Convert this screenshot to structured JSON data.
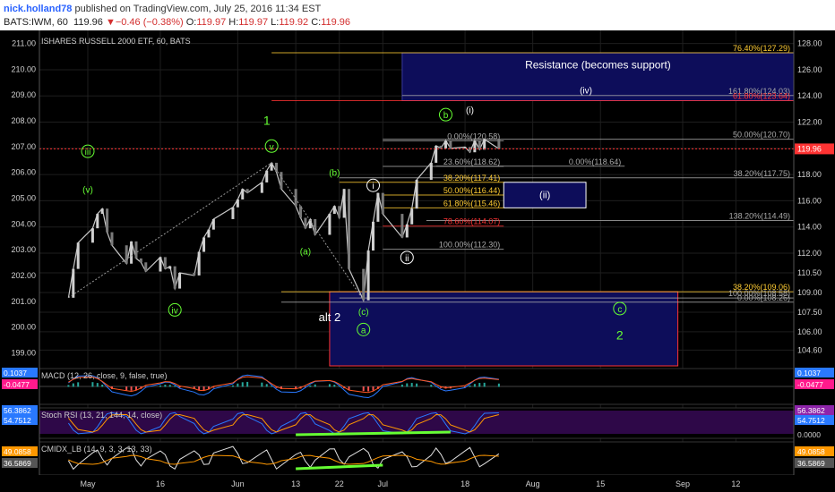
{
  "header": {
    "user": "nick.holland78",
    "published": " published on TradingView.com, July 25, 2016 11:34 EST",
    "symbol": "BATS:IWM, 60",
    "last": "119.96",
    "change_arrow": "▼",
    "change": "−0.46 (−0.38%)",
    "o_label": "O:",
    "o_value": "119.97",
    "h_label": "H:",
    "h_value": "119.97",
    "l_label": "L:",
    "l_value": "119.92",
    "c_label": "C:",
    "c_value": "119.96"
  },
  "colors": {
    "background": "#000000",
    "grid": "#1e1e1e",
    "axis_text": "#d0d0d0",
    "candle": "#c8c8c8",
    "wave_green": "#66ff33",
    "wave_white": "#ffffff",
    "box_navy": "#0d0d5a",
    "box_red_border": "#ff3333",
    "fib_red": "#ff3333",
    "fib_gold": "#ffcc33",
    "fib_gray": "#aaaaaa",
    "macd": "#2979ff",
    "signal": "#ff5722",
    "hist_pos": "#26a69a",
    "hist_neg": "#ef5350",
    "rsi_k": "#2979ff",
    "rsi_d": "#ff9800",
    "rsi_band": "#3a0a5a",
    "divergence": "#66ff33",
    "last_price": "#ff3333",
    "cmi_color": "#e0e0e0"
  },
  "chart_data": {
    "type": "line",
    "title": "ISHARES RUSSELL 2000 ETF, 60, BATS",
    "left_axis": {
      "ticks": [
        "211.00",
        "210.00",
        "209.00",
        "208.00",
        "207.00",
        "206.00",
        "205.00",
        "204.00",
        "203.00",
        "202.00",
        "201.00",
        "200.00",
        "199.00"
      ],
      "range": [
        198.5,
        211.5
      ]
    },
    "right_axis": {
      "ticks": [
        "128.00",
        "126.00",
        "124.00",
        "122.00",
        "120.00",
        "118.00",
        "116.00",
        "114.00",
        "112.00",
        "110.50",
        "109.00",
        "107.50",
        "106.00",
        "104.60"
      ],
      "range": [
        103.4,
        129.0
      ]
    },
    "x_ticks": [
      "May",
      "16",
      "Jun",
      "13",
      "22",
      "Jul",
      "18",
      "Aug",
      "15",
      "Sep",
      "12"
    ],
    "last_price": "119.96",
    "price_series": [
      {
        "t": "Apr 27",
        "v": 108.6
      },
      {
        "t": "Apr 28",
        "v": 110.8
      },
      {
        "t": "Apr 29",
        "v": 112.8
      },
      {
        "t": "May 02",
        "v": 113.9
      },
      {
        "t": "May 03",
        "v": 115.0
      },
      {
        "t": "May 04",
        "v": 115.4
      },
      {
        "t": "May 05",
        "v": 113.6
      },
      {
        "t": "May 06",
        "v": 112.6
      },
      {
        "t": "May 09",
        "v": 111.2
      },
      {
        "t": "May 10",
        "v": 112.9
      },
      {
        "t": "May 11",
        "v": 111.6
      },
      {
        "t": "May 12",
        "v": 111.3
      },
      {
        "t": "May 13",
        "v": 110.6
      },
      {
        "t": "May 16",
        "v": 111.7
      },
      {
        "t": "May 17",
        "v": 110.8
      },
      {
        "t": "May 18",
        "v": 111.0
      },
      {
        "t": "May 19",
        "v": 109.3
      },
      {
        "t": "May 20",
        "v": 110.5
      },
      {
        "t": "May 23",
        "v": 110.3
      },
      {
        "t": "May 24",
        "v": 112.1
      },
      {
        "t": "May 25",
        "v": 113.2
      },
      {
        "t": "May 26",
        "v": 113.8
      },
      {
        "t": "May 27",
        "v": 114.6
      },
      {
        "t": "May 31",
        "v": 115.5
      },
      {
        "t": "Jun 01",
        "v": 116.1
      },
      {
        "t": "Jun 02",
        "v": 116.9
      },
      {
        "t": "Jun 03",
        "v": 116.6
      },
      {
        "t": "Jun 06",
        "v": 117.4
      },
      {
        "t": "Jun 07",
        "v": 118.3
      },
      {
        "t": "Jun 08",
        "v": 118.9
      },
      {
        "t": "Jun 09",
        "v": 118.2
      },
      {
        "t": "Jun 10",
        "v": 116.9
      },
      {
        "t": "Jun 13",
        "v": 115.6
      },
      {
        "t": "Jun 14",
        "v": 114.7
      },
      {
        "t": "Jun 15",
        "v": 113.9
      },
      {
        "t": "Jun 16",
        "v": 114.6
      },
      {
        "t": "Jun 17",
        "v": 113.4
      },
      {
        "t": "Jun 20",
        "v": 115.0
      },
      {
        "t": "Jun 21",
        "v": 115.6
      },
      {
        "t": "Jun 22",
        "v": 114.7
      },
      {
        "t": "Jun 23",
        "v": 116.9
      },
      {
        "t": "Jun 24",
        "v": 110.8
      },
      {
        "t": "Jun 27",
        "v": 108.4
      },
      {
        "t": "Jun 28",
        "v": 112.2
      },
      {
        "t": "Jun 29",
        "v": 114.4
      },
      {
        "t": "Jun 30",
        "v": 116.6
      },
      {
        "t": "Jul 01",
        "v": 115.0
      },
      {
        "t": "Jul 05",
        "v": 113.2
      },
      {
        "t": "Jul 06",
        "v": 114.2
      },
      {
        "t": "Jul 07",
        "v": 115.4
      },
      {
        "t": "Jul 08",
        "v": 117.6
      },
      {
        "t": "Jul 11",
        "v": 118.9
      },
      {
        "t": "Jul 12",
        "v": 120.2
      },
      {
        "t": "Jul 13",
        "v": 120.0
      },
      {
        "t": "Jul 14",
        "v": 120.6
      },
      {
        "t": "Jul 15",
        "v": 120.0
      },
      {
        "t": "Jul 18",
        "v": 120.1
      },
      {
        "t": "Jul 19",
        "v": 119.7
      },
      {
        "t": "Jul 20",
        "v": 120.6
      },
      {
        "t": "Jul 21",
        "v": 119.9
      },
      {
        "t": "Jul 22",
        "v": 120.7
      },
      {
        "t": "Jul 25",
        "v": 119.96
      }
    ],
    "fib_levels": [
      {
        "label": "76.40%(127.29)",
        "v": 127.29,
        "color": "gold"
      },
      {
        "label": "161.80%(124.03)",
        "v": 124.03,
        "color": "gray"
      },
      {
        "label": "61.80%(123.64)",
        "v": 123.64,
        "color": "red"
      },
      {
        "label": "50.00%(120.70)",
        "v": 120.7,
        "color": "gray"
      },
      {
        "label": "0.00%(120.58)",
        "v": 120.58,
        "color": "gray"
      },
      {
        "label": "23.60%(118.62)",
        "v": 118.62,
        "color": "gray"
      },
      {
        "label": "0.00%(118.64)",
        "v": 118.64,
        "color": "gray"
      },
      {
        "label": "38.20%(117.75)",
        "v": 117.75,
        "color": "gray"
      },
      {
        "label": "38.20%(117.41)",
        "v": 117.41,
        "color": "gold"
      },
      {
        "label": "50.00%(116.44)",
        "v": 116.44,
        "color": "gold"
      },
      {
        "label": "61.80%(115.46)",
        "v": 115.46,
        "color": "gold"
      },
      {
        "label": "138.20%(114.49)",
        "v": 114.49,
        "color": "gray"
      },
      {
        "label": "78.60%(114.07)",
        "v": 114.07,
        "color": "red"
      },
      {
        "label": "100.00%(112.30)",
        "v": 112.3,
        "color": "gray"
      },
      {
        "label": "38.20%(109.06)",
        "v": 109.06,
        "color": "gold"
      },
      {
        "label": "100.00%(108.58)",
        "v": 108.58,
        "color": "gray"
      },
      {
        "label": "0.00%(108.26)",
        "v": 108.26,
        "color": "gray"
      }
    ],
    "waves": [
      {
        "label": "iii",
        "circle": true,
        "t": "May 01",
        "v": 119.5,
        "color": "green"
      },
      {
        "label": "(v)",
        "circle": false,
        "t": "May 01",
        "v": 116.6,
        "color": "green"
      },
      {
        "label": "iv",
        "circle": true,
        "t": "May 19",
        "v": 107.4,
        "color": "green"
      },
      {
        "label": "1",
        "circle": false,
        "t": "Jun 07",
        "v": 121.8,
        "color": "green"
      },
      {
        "label": "v",
        "circle": true,
        "t": "Jun 08",
        "v": 119.9,
        "color": "green"
      },
      {
        "label": "(a)",
        "circle": false,
        "t": "Jun 15",
        "v": 111.9,
        "color": "green"
      },
      {
        "label": "(b)",
        "circle": false,
        "t": "Jun 21",
        "v": 117.9,
        "color": "green"
      },
      {
        "label": "alt 2",
        "circle": false,
        "t": "Jun 20",
        "v": 106.8,
        "color": "white"
      },
      {
        "label": "(c)",
        "circle": false,
        "t": "Jun 27",
        "v": 107.3,
        "color": "green"
      },
      {
        "label": "a",
        "circle": true,
        "t": "Jun 27",
        "v": 105.9,
        "color": "green"
      },
      {
        "label": "i",
        "circle": true,
        "t": "Jun 29",
        "v": 116.9,
        "color": "white"
      },
      {
        "label": "ii",
        "circle": true,
        "t": "Jul 06",
        "v": 111.4,
        "color": "white"
      },
      {
        "label": "b",
        "circle": true,
        "t": "Jul 14",
        "v": 122.3,
        "color": "green"
      },
      {
        "label": "(i)",
        "circle": false,
        "t": "Jul 19",
        "v": 122.7,
        "color": "white"
      },
      {
        "label": "(iv)",
        "circle": false,
        "t": "Aug 12",
        "v": 124.2,
        "color": "white"
      },
      {
        "label": "c",
        "circle": true,
        "t": "Aug 19",
        "v": 107.5,
        "color": "green"
      },
      {
        "label": "2",
        "circle": false,
        "t": "Aug 19",
        "v": 105.4,
        "color": "green"
      }
    ],
    "annotations": {
      "resistance_label": "Resistance (becomes support)",
      "ii_label": "(ii)"
    },
    "indicators": {
      "macd": {
        "label": "MACD (12, 26, close, 9, false, true)",
        "value1": "0.1037",
        "value2": "-0.0477",
        "left1": "0.1037",
        "left2": "-0.0477"
      },
      "stoch_rsi": {
        "label": "Stoch RSI (13, 21, 144, 14, close)",
        "value1": "56.3862",
        "value2": "54.7512",
        "left1": "56.3862",
        "left2": "54.7512",
        "right_zero": "0.0000"
      },
      "cmi": {
        "label": "CMIDX_LB (14, 9, 3, 3, 13, 33)",
        "value1": "49.0858",
        "value2": "36.5869",
        "left1": "49.0858",
        "left2": "36.5869"
      }
    }
  }
}
